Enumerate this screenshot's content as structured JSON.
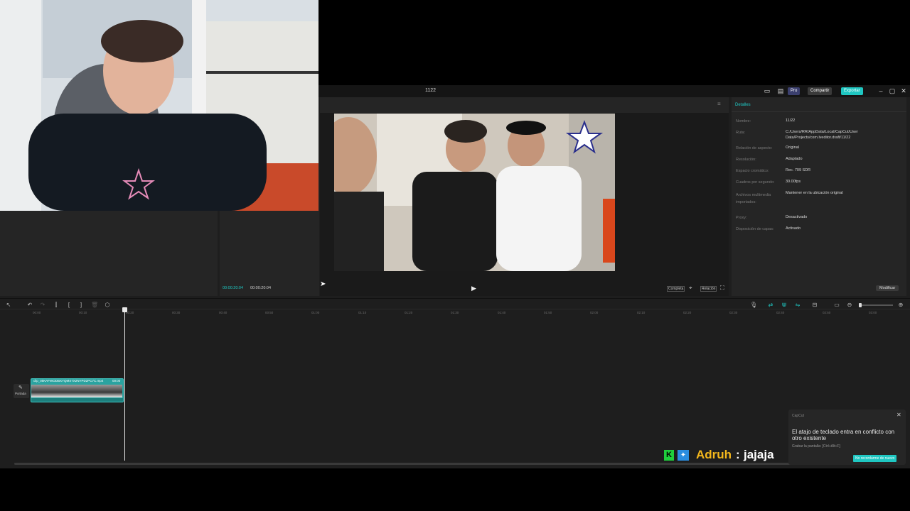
{
  "window": {
    "title": "1122"
  },
  "topbar": {
    "pro_label": "Pro",
    "share_label": "Compartir",
    "export_label": "Exportar"
  },
  "player": {
    "current_time": "00:00:20:04",
    "total_time": "00:00:20:04",
    "complete_label": "Completa",
    "ratio_label": "Relación"
  },
  "details": {
    "tab_label": "Detalles",
    "fields": [
      {
        "label": "Nombre:",
        "value": "11/22"
      },
      {
        "label": "Ruta:",
        "value": "C:/Users/RR/AppData/Local/CapCut/User Data/Projects/com.lveditor.draft/11/22"
      },
      {
        "label": "Relación de aspecto:",
        "value": "Original"
      },
      {
        "label": "Resolución:",
        "value": "Adaptado"
      },
      {
        "label": "Espacio cromático:",
        "value": "Rec. 709 SDR"
      },
      {
        "label": "Cuadros por segundo:",
        "value": "30.00fps"
      },
      {
        "label": "Archivos multimedia importados:",
        "value": "Mantener en la ubicación original"
      },
      {
        "label": "Proxy:",
        "value": "Desactivado"
      },
      {
        "label": "Disposición de capas:",
        "value": "Activado"
      }
    ],
    "modify_label": "Modificar"
  },
  "timeline": {
    "ruler": [
      "00:00",
      "00:10",
      "00:20",
      "00:30",
      "00:40",
      "00:50",
      "01:00",
      "01:10",
      "01:20",
      "01:30",
      "01:40",
      "01:50",
      "02:00",
      "02:10",
      "02:20",
      "02:30",
      "02:40",
      "02:50",
      "03:00"
    ],
    "cover_label": "Portada",
    "clip_name": "clip_05KAFWODBXYQMX7X2NYPD2PC7C.mp4",
    "clip_duration": "00:00"
  },
  "toast": {
    "app": "CapCut",
    "message": "El atajo de teclado entra en conflicto con otro existente",
    "detail": "Grabar la pantalla: [Ctrl+Alt+F]",
    "action": "No recordarme de nuevo"
  },
  "chat": {
    "user": "Adruh",
    "separator": ":",
    "message": "jajaja"
  },
  "colors": {
    "accent": "#1fc7c2",
    "clip": "#2aa3a0",
    "chat_user": "#f5b81c"
  }
}
